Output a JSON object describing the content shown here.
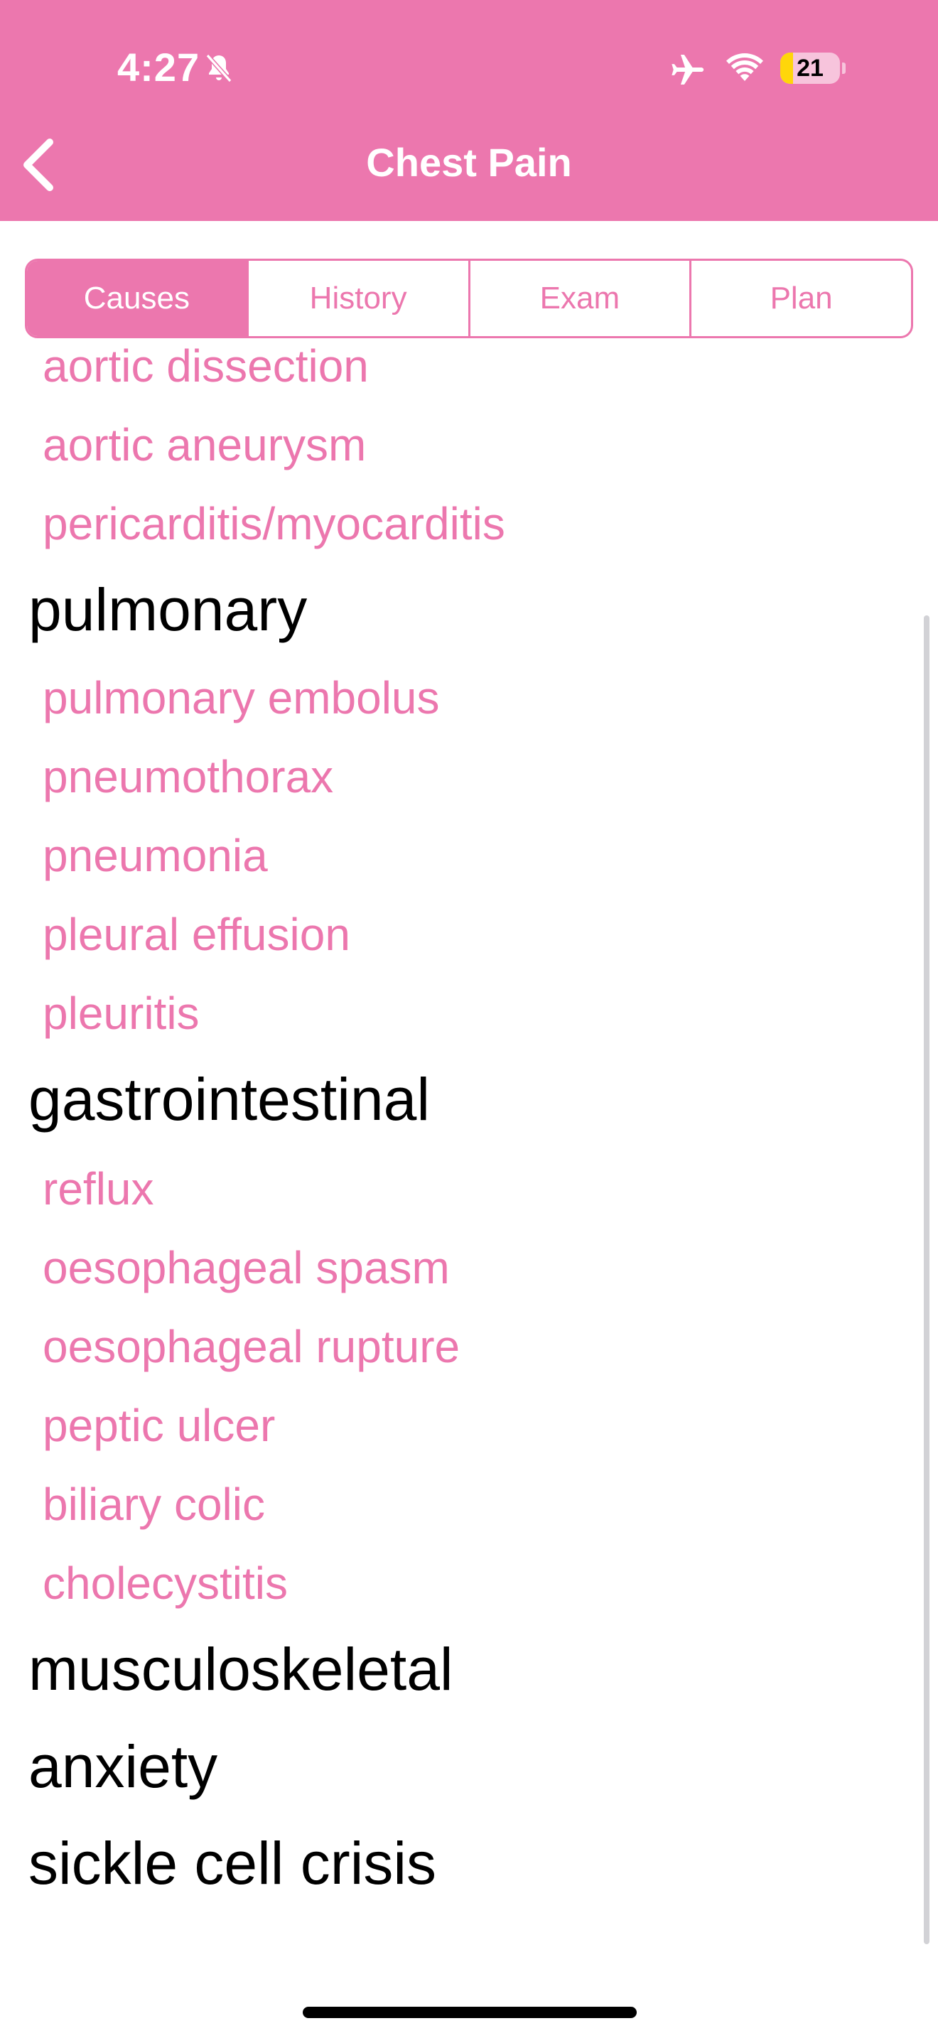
{
  "status_bar": {
    "time": "4:27",
    "battery_level": "21",
    "battery_fraction": 0.21,
    "icons": [
      "bell-slash-icon",
      "airplane-icon",
      "wifi-icon",
      "battery-icon"
    ]
  },
  "nav": {
    "title": "Chest Pain",
    "back_icon": "chevron-left-icon"
  },
  "tabs": [
    {
      "label": "Causes",
      "active": true
    },
    {
      "label": "History",
      "active": false
    },
    {
      "label": "Exam",
      "active": false
    },
    {
      "label": "Plan",
      "active": false
    }
  ],
  "list": {
    "cardiac_items": [
      "aortic dissection",
      "aortic aneurysm",
      "pericarditis/myocarditis"
    ],
    "pulmonary": {
      "title": "pulmonary",
      "items": [
        "pulmonary embolus",
        "pneumothorax",
        "pneumonia",
        "pleural effusion",
        "pleuritis"
      ]
    },
    "gastrointestinal": {
      "title": "gastrointestinal",
      "items": [
        "reflux",
        "oesophageal spasm",
        "oesophageal rupture",
        "peptic ulcer",
        "biliary colic",
        "cholecystitis"
      ]
    },
    "other_headers": [
      "musculoskeletal",
      "anxiety",
      "sickle cell crisis"
    ]
  },
  "colors": {
    "accent": "#EC77AE",
    "header_text": "#FFFFFF",
    "category_text": "#000000",
    "battery_fill": "#FFD60A"
  }
}
